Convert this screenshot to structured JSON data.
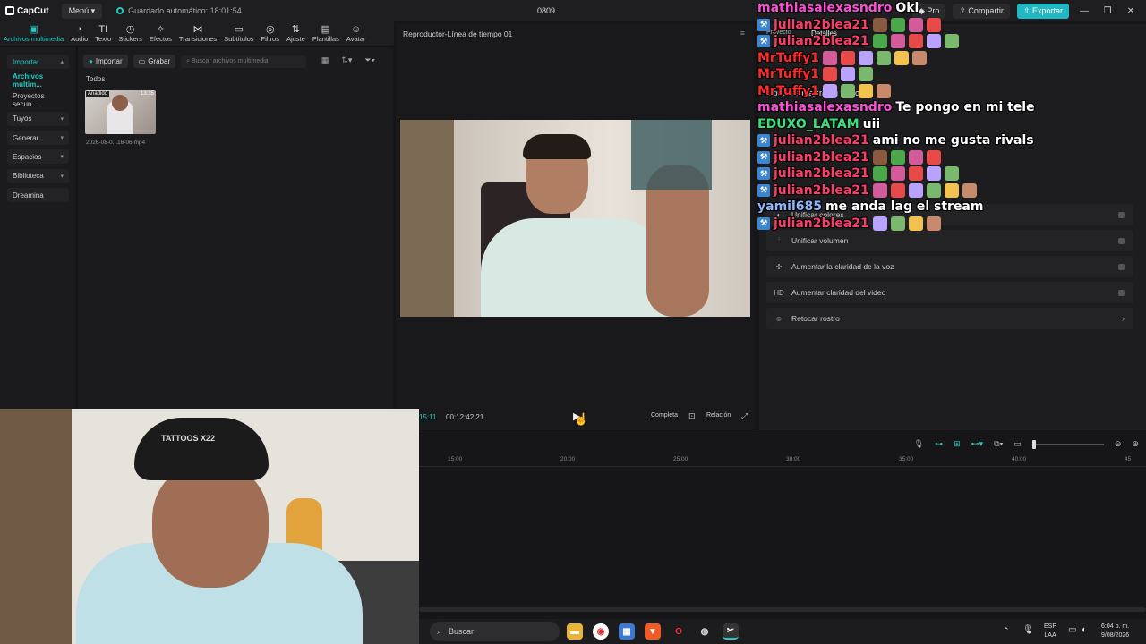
{
  "titlebar": {
    "app_name": "CapCut",
    "menu_label": "Menú",
    "autosave": "Guardado automático: 18:01:54",
    "project_title": "0809",
    "pro_label": "Pro",
    "share_label": "Compartir",
    "export_label": "Exportar"
  },
  "toolbar": {
    "tools": [
      {
        "label": "Archivos multimedia",
        "icon": "media-icon"
      },
      {
        "label": "Audio",
        "icon": "audio-icon"
      },
      {
        "label": "Texto",
        "icon": "text-icon"
      },
      {
        "label": "Stickers",
        "icon": "sticker-icon"
      },
      {
        "label": "Efectos",
        "icon": "effects-icon"
      },
      {
        "label": "Transiciones",
        "icon": "transition-icon"
      },
      {
        "label": "Subtítulos",
        "icon": "subtitle-icon"
      },
      {
        "label": "Filtros",
        "icon": "filter-icon"
      },
      {
        "label": "Ajuste",
        "icon": "adjust-icon"
      },
      {
        "label": "Plantillas",
        "icon": "template-icon"
      },
      {
        "label": "Avatar",
        "icon": "avatar-icon"
      }
    ]
  },
  "leftnav": {
    "items": [
      {
        "label": "Importar"
      },
      {
        "label": "Archivos multim..."
      },
      {
        "label": "Proyectos secun..."
      },
      {
        "label": "Tuyos"
      },
      {
        "label": "Generar"
      },
      {
        "label": "Espacios"
      },
      {
        "label": "Biblioteca"
      },
      {
        "label": "Dreamina"
      }
    ]
  },
  "media": {
    "import_label": "Importar",
    "record_label": "Grabar",
    "search_placeholder": "Buscar archivos multimedia",
    "filter_all": "Todos",
    "clip_tag": "Añadido",
    "clip_duration": "13:35",
    "clip_filename": "2026-08-0...16-06.mp4"
  },
  "player": {
    "title": "Reproductor-Línea de tiempo 01",
    "current_time": "15:11",
    "total_time": "00:12:42:21",
    "full_label": "Completa",
    "ratio_label": "Relación"
  },
  "rightpanel": {
    "tab_project": "Proyecto",
    "tab_details": "Detalles",
    "improve_text": "...puedes mejorar tu video",
    "rows": [
      {
        "label": "Unificar colores",
        "icon": "color-icon"
      },
      {
        "label": "Unificar volumen",
        "icon": "volume-eq-icon"
      },
      {
        "label": "Aumentar la claridad de la voz",
        "icon": "voice-icon"
      },
      {
        "label": "Aumentar claridad del video",
        "icon": "hd-icon",
        "icon_text": "HD"
      },
      {
        "label": "Retocar rostro",
        "icon": "face-icon"
      }
    ]
  },
  "chat": {
    "lines": [
      {
        "user": "mathiasalexasndro",
        "color": "#ff4fd8",
        "msg": "Oki",
        "badge": false
      },
      {
        "user": "julian2blea21",
        "color": "#ff3b6b",
        "msg": "",
        "badge": true
      },
      {
        "user": "julian2blea21",
        "color": "#ff3b6b",
        "msg": "",
        "badge": true
      },
      {
        "user": "MrTuffy1",
        "color": "#ff2a2a",
        "msg": "",
        "badge": false
      },
      {
        "user": "MrTuffy1",
        "color": "#ff2a2a",
        "msg": "",
        "badge": false
      },
      {
        "user": "MrTuffy1",
        "color": "#ff2a2a",
        "msg": "",
        "badge": false
      },
      {
        "user": "mathiasalexasndro",
        "color": "#ff4fd8",
        "msg": "Te pongo en mi tele",
        "badge": false
      },
      {
        "user": "EDUXO_LATAM",
        "color": "#37e07a",
        "msg": "uii",
        "badge": false
      },
      {
        "user": "julian2blea21",
        "color": "#ff3b6b",
        "msg": "ami no me gusta rivals",
        "badge": true
      },
      {
        "user": "julian2blea21",
        "color": "#ff3b6b",
        "msg": "",
        "badge": true
      },
      {
        "user": "julian2blea21",
        "color": "#ff3b6b",
        "msg": "",
        "badge": true
      },
      {
        "user": "julian2blea21",
        "color": "#ff3b6b",
        "msg": "",
        "badge": true
      },
      {
        "user": "yamil685",
        "color": "#8fb6ff",
        "msg": "me anda lag el stream",
        "badge": false
      },
      {
        "user": "julian2blea21",
        "color": "#ff3b6b",
        "msg": "",
        "badge": true
      }
    ]
  },
  "timeline": {
    "ticks": [
      "15:00",
      "20:00",
      "25:00",
      "30:00",
      "35:00",
      "40:00",
      "45"
    ]
  },
  "webcam": {
    "cap_text": "TATTOOS X22"
  },
  "taskbar": {
    "search_label": "Buscar",
    "lang": "ESP",
    "lang2": "LAA",
    "time": "6:04 p. m.",
    "date": "9/08/2026"
  }
}
